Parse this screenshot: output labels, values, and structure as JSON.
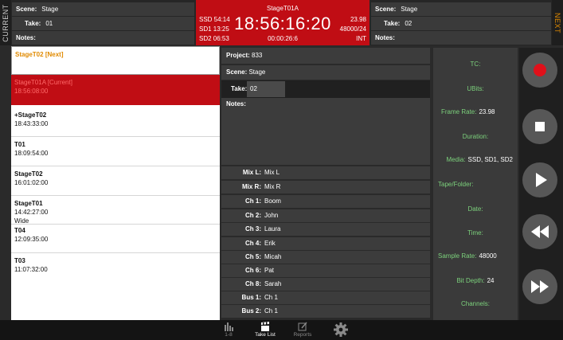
{
  "current": {
    "side_label": "CURRENT",
    "scene_label": "Scene:",
    "scene_value": "Stage",
    "take_label": "Take:",
    "take_value": "01",
    "notes_label": "Notes:"
  },
  "clock": {
    "title": "StageT01A",
    "time": "18:56:16:20",
    "sub": "00:00:26:6",
    "left_lines": [
      "SSD 54:14",
      "SD1 13:25",
      "SD2 06:53"
    ],
    "right_lines": [
      "23.98",
      "48000/24",
      "INT"
    ]
  },
  "next": {
    "side_label": "NEXT",
    "scene_label": "Scene:",
    "scene_value": "Stage",
    "take_label": "Take:",
    "take_value": "02",
    "notes_label": "Notes:"
  },
  "take_list": {
    "next_item": {
      "name": "StageT02",
      "tag": "[Next]"
    },
    "current_item": {
      "name": "StageT01A",
      "tag": "[Current]",
      "time": "18:56:08:00"
    },
    "items": [
      {
        "name": "+StageT02",
        "time": "18:43:33:00",
        "note": ""
      },
      {
        "name": "T01",
        "time": "18:09:54:00",
        "note": ""
      },
      {
        "name": "StageT02",
        "time": "16:01:02:00",
        "note": ""
      },
      {
        "name": "StageT01",
        "time": "14:42:27:00",
        "note": "Wide"
      },
      {
        "name": "T04",
        "time": "12:09:35:00",
        "note": ""
      },
      {
        "name": "T03",
        "time": "11:07:32:00",
        "note": ""
      }
    ]
  },
  "project": {
    "project_label": "Project:",
    "project_value": "833",
    "scene_label": "Scene:",
    "scene_value": "Stage",
    "take_label": "Take:",
    "take_value": "02",
    "notes_label": "Notes:"
  },
  "channels": [
    {
      "label": "Mix L:",
      "value": "Mix L"
    },
    {
      "label": "Mix R:",
      "value": "Mix R"
    },
    {
      "label": "Ch 1:",
      "value": "Boom"
    },
    {
      "label": "Ch 2:",
      "value": "John"
    },
    {
      "label": "Ch 3:",
      "value": "Laura"
    },
    {
      "label": "Ch 4:",
      "value": "Erik"
    },
    {
      "label": "Ch 5:",
      "value": "Micah"
    },
    {
      "label": "Ch 6:",
      "value": "Pat"
    },
    {
      "label": "Ch 8:",
      "value": "Sarah"
    },
    {
      "label": "Bus 1:",
      "value": "Ch 1"
    },
    {
      "label": "Bus 2:",
      "value": "Ch 1"
    }
  ],
  "metadata": {
    "tc": "TC:",
    "ubits": "UBits:",
    "frame_rate_label": "Frame Rate:",
    "frame_rate_value": "23.98",
    "duration": "Duration:",
    "media_label": "Media:",
    "media_value": "SSD, SD1, SD2",
    "tape_folder": "Tape/Folder:",
    "date": "Date:",
    "time": "Time:",
    "sample_rate_label": "Sample Rate:",
    "sample_rate_value": "48000",
    "bit_depth_label": "Bit Depth:",
    "bit_depth_value": "24",
    "channels": "Channels:"
  },
  "tabs": [
    {
      "label": "1-8",
      "icon": "meters-icon",
      "active": false
    },
    {
      "label": "Take List",
      "icon": "clapperboard-icon",
      "active": true
    },
    {
      "label": "Reports",
      "icon": "edit-icon",
      "active": false
    },
    {
      "label": "",
      "icon": "gear-icon",
      "active": false
    }
  ],
  "colors": {
    "clock_bg": "#c00d14",
    "record": "#e0101a",
    "next_item_text": "#e08a00",
    "meta_label": "#7cd17c"
  }
}
